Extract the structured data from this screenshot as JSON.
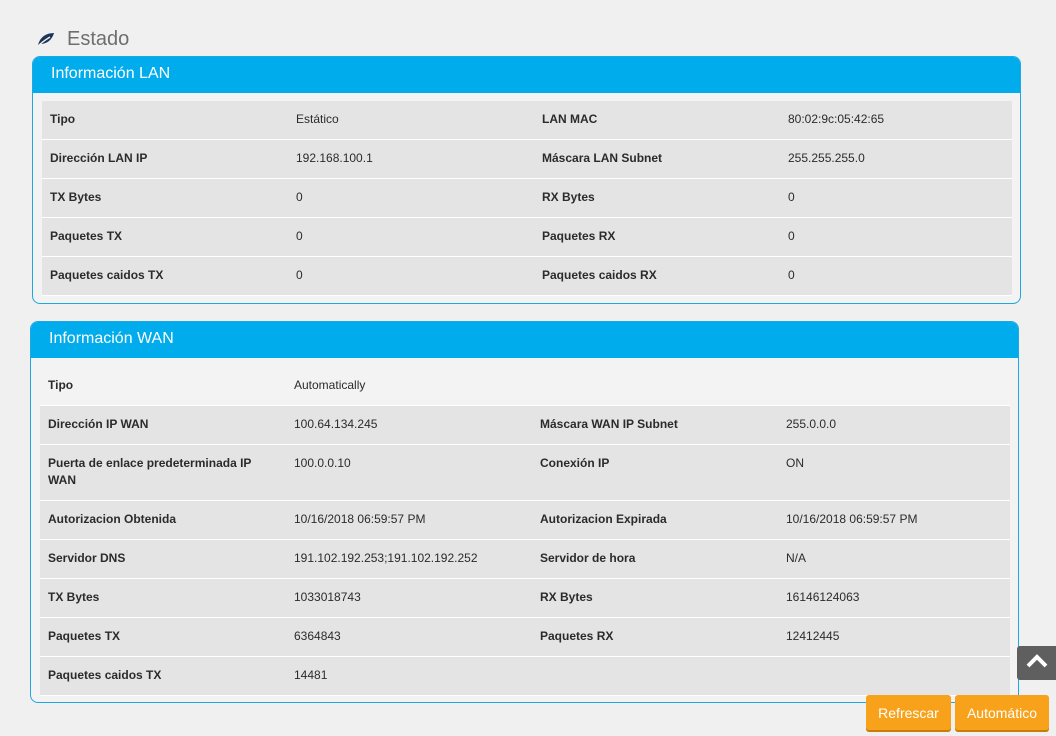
{
  "page": {
    "title": "Estado"
  },
  "lan": {
    "title": "Información LAN",
    "rows": [
      {
        "l1": "Tipo",
        "v1": "Estático",
        "l2": "LAN MAC",
        "v2": "80:02:9c:05:42:65"
      },
      {
        "l1": "Dirección LAN IP",
        "v1": "192.168.100.1",
        "l2": "Máscara LAN Subnet",
        "v2": "255.255.255.0"
      },
      {
        "l1": "TX Bytes",
        "v1": "0",
        "l2": "RX Bytes",
        "v2": "0"
      },
      {
        "l1": "Paquetes TX",
        "v1": "0",
        "l2": "Paquetes RX",
        "v2": "0"
      },
      {
        "l1": "Paquetes caidos TX",
        "v1": "0",
        "l2": "Paquetes caidos RX",
        "v2": "0"
      }
    ]
  },
  "wan": {
    "title": "Información WAN",
    "rows": [
      {
        "l1": "Tipo",
        "v1": "Automatically",
        "l2": "",
        "v2": ""
      },
      {
        "l1": "Dirección IP WAN",
        "v1": "100.64.134.245",
        "l2": "Máscara WAN IP Subnet",
        "v2": "255.0.0.0"
      },
      {
        "l1": "Puerta de enlace predeterminada IP WAN",
        "v1": "100.0.0.10",
        "l2": "Conexión IP",
        "v2": "ON"
      },
      {
        "l1": "Autorizacion Obtenida",
        "v1": "10/16/2018 06:59:57 PM",
        "l2": "Autorizacion Expirada",
        "v2": "10/16/2018 06:59:57 PM"
      },
      {
        "l1": "Servidor DNS",
        "v1": "191.102.192.253;191.102.192.252",
        "l2": "Servidor de hora",
        "v2": "N/A"
      },
      {
        "l1": "TX Bytes",
        "v1": "1033018743",
        "l2": "RX Bytes",
        "v2": "16146124063"
      },
      {
        "l1": "Paquetes TX",
        "v1": "6364843",
        "l2": "Paquetes RX",
        "v2": "12412445"
      },
      {
        "l1": "Paquetes caidos TX",
        "v1": "14481",
        "l2": "",
        "v2": ""
      }
    ]
  },
  "buttons": {
    "refresh_label": "Refrescar",
    "auto_label": "Automático"
  },
  "colors": {
    "accent": "#00acec",
    "button": "#f7a21a",
    "leaf": "#1d3557"
  }
}
